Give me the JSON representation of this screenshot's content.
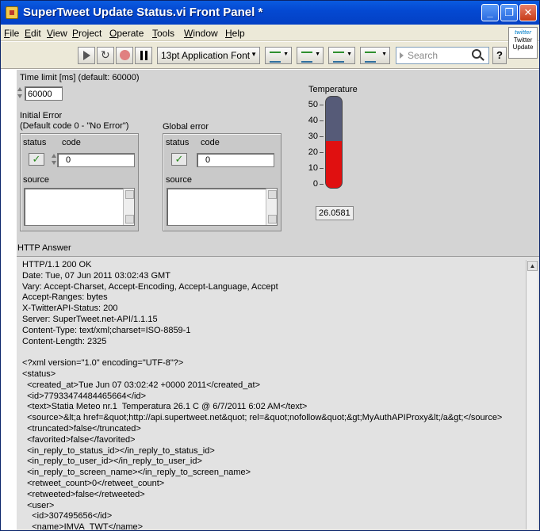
{
  "window": {
    "title": "SuperTweet Update Status.vi Front Panel *",
    "min_glyph": "_",
    "max_glyph": "❐",
    "close_glyph": "✕"
  },
  "menu": [
    "File",
    "Edit",
    "View",
    "Project",
    "Operate",
    "Tools",
    "Window",
    "Help"
  ],
  "toolbar": {
    "font_label": "13pt Application Font",
    "search_placeholder": "Search",
    "help_label": "?"
  },
  "twitter_badge": {
    "brand": "twitter",
    "line1": "Twitter",
    "line2": "Update"
  },
  "time_limit": {
    "label": "Time limit [ms] (default: 60000)",
    "value": "60000"
  },
  "initial_error": {
    "label_line1": "Initial Error",
    "label_line2": "(Default code 0 - \"No Error\")",
    "status_label": "status",
    "code_label": "code",
    "code_value": "0",
    "source_label": "source",
    "status_glyph": "✓"
  },
  "global_error": {
    "label": "Global error",
    "status_label": "status",
    "code_label": "code",
    "code_value": "0",
    "source_label": "source",
    "status_glyph": "✓"
  },
  "temperature": {
    "label": "Temperature",
    "scale_ticks": [
      "50",
      "40",
      "30",
      "20",
      "10",
      "0"
    ],
    "scale_min": 0,
    "scale_max": 50,
    "value": 26.0581,
    "readout": "26.0581",
    "fill_color": "#e01010",
    "empty_color": "#565b78"
  },
  "http_answer": {
    "label": "HTTP Answer",
    "lines": [
      "HTTP/1.1 200 OK",
      "Date: Tue, 07 Jun 2011 03:02:43 GMT",
      "Vary: Accept-Charset, Accept-Encoding, Accept-Language, Accept",
      "Accept-Ranges: bytes",
      "X-TwitterAPI-Status: 200",
      "Server: SuperTweet.net-API/1.1.15",
      "Content-Type: text/xml;charset=ISO-8859-1",
      "Content-Length: 2325",
      "",
      "<?xml version=\"1.0\" encoding=\"UTF-8\"?>",
      "<status>",
      "  <created_at>Tue Jun 07 03:02:42 +0000 2011</created_at>",
      "  <id>77933474484465664</id>",
      "  <text>Statia Meteo nr.1  Temperatura 26.1 C @ 6/7/2011 6:02 AM</text>",
      "  <source>&lt;a href=&quot;http://api.supertweet.net&quot; rel=&quot;nofollow&quot;&gt;MyAuthAPIProxy&lt;/a&gt;</source>",
      "  <truncated>false</truncated>",
      "  <favorited>false</favorited>",
      "  <in_reply_to_status_id></in_reply_to_status_id>",
      "  <in_reply_to_user_id></in_reply_to_user_id>",
      "  <in_reply_to_screen_name></in_reply_to_screen_name>",
      "  <retweet_count>0</retweet_count>",
      "  <retweeted>false</retweeted>",
      "  <user>",
      "    <id>307495656</id>",
      "    <name>IMVA_TWT</name>"
    ]
  }
}
